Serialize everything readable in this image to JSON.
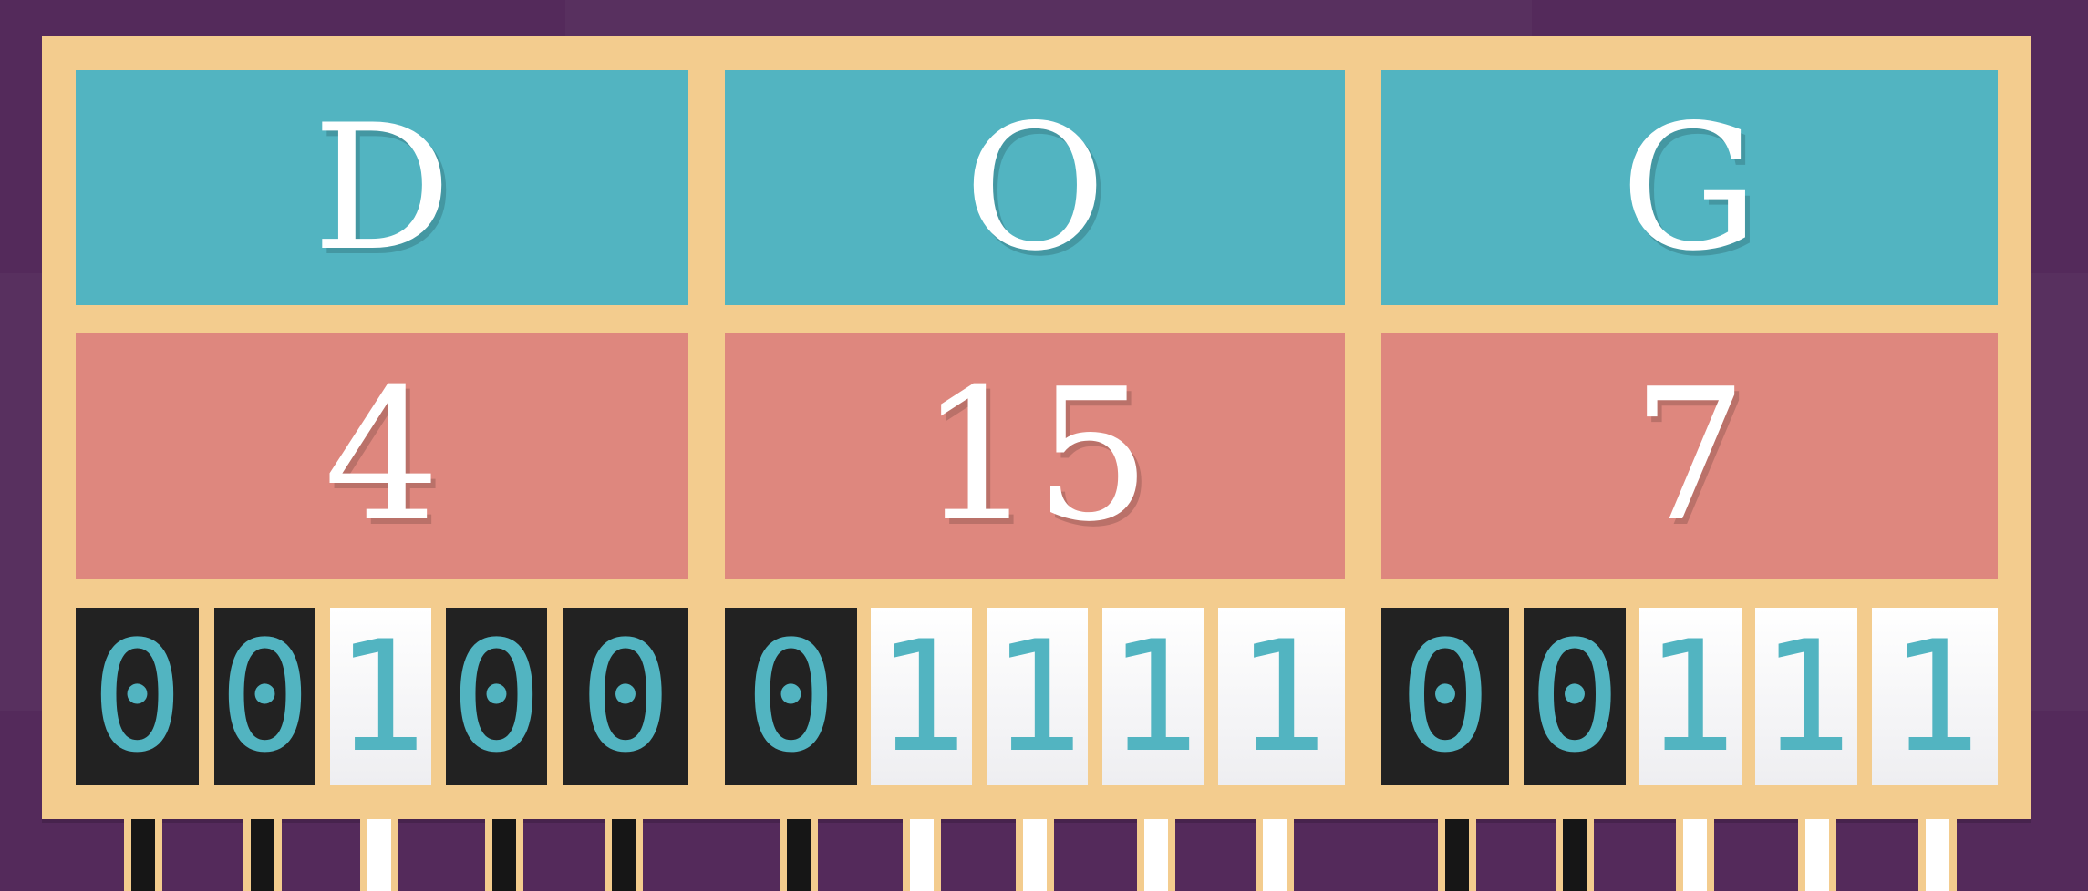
{
  "letters": [
    "D",
    "O",
    "G"
  ],
  "numbers": [
    "4",
    "15",
    "7"
  ],
  "bits": {
    "d": [
      "0",
      "0",
      "1",
      "0",
      "0"
    ],
    "o": [
      "0",
      "1",
      "1",
      "1",
      "1"
    ],
    "g": [
      "0",
      "0",
      "1",
      "1",
      "1"
    ]
  },
  "colors": {
    "background": "#542a5b",
    "board": "#f3cc8e",
    "letter_cell": "#52b4c1",
    "number_cell": "#de877e",
    "bit_off": "#222222",
    "bit_on": "#ffffff",
    "bit_digit": "#52b4c1"
  }
}
